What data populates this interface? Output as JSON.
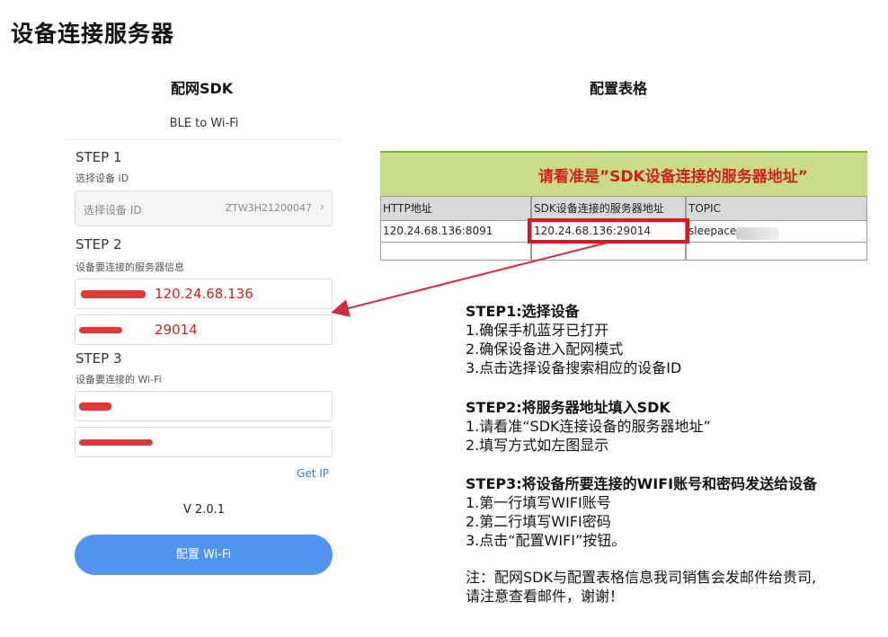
{
  "page": {
    "title": "设备连接服务器"
  },
  "columns": {
    "left_title": "配网SDK",
    "right_title": "配置表格"
  },
  "app": {
    "header": "BLE to Wi-Fi",
    "step1": {
      "title": "STEP 1",
      "subtitle": "选择设备 ID",
      "select_placeholder": "选择设备 ID",
      "device_id": "ZTW3H21200047"
    },
    "step2": {
      "title": "STEP 2",
      "subtitle": "设备要连接的服务器信息",
      "server_ip": "120.24.68.136",
      "server_port": "29014"
    },
    "step3": {
      "title": "STEP 3",
      "subtitle": "设备要连接的 Wi-Fi"
    },
    "get_ip": "Get IP",
    "version": "V 2.0.1",
    "config_button": "配置 Wi-Fi"
  },
  "sheet": {
    "banner": "请看准是”SDK设备连接的服务器地址”",
    "headers": [
      "HTTP地址",
      "SDK设备连接的服务器地址",
      "TOPIC"
    ],
    "row": [
      "120.24.68.136:8091",
      "120.24.68.136:29014",
      "sleepace-"
    ]
  },
  "instructions": {
    "step1": {
      "heading": "STEP1:选择设备",
      "lines": [
        "1.确保手机蓝牙已打开",
        "2.确保设备进入配网模式",
        "3.点击选择设备搜索相应的设备ID"
      ]
    },
    "step2": {
      "heading": "STEP2:将服务器地址填入SDK",
      "lines": [
        "1.请看准“SDK连接设备的服务器地址”",
        "2.填写方式如左图显示"
      ]
    },
    "step3": {
      "heading": "STEP3:将设备所要连接的WIFI账号和密码发送给设备",
      "lines": [
        "1.第一行填写WIFI账号",
        "2.第二行填写WIFI密码",
        "3.点击“配置WIFI”按钮。"
      ]
    },
    "note": [
      "注：配网SDK与配置表格信息我司销售会发邮件给贵司,",
      "请注意查看邮件，谢谢！"
    ]
  },
  "colors": {
    "accent_red": "#d32020",
    "button_blue": "#4f94ef",
    "banner_green": "#c8dc8a"
  }
}
